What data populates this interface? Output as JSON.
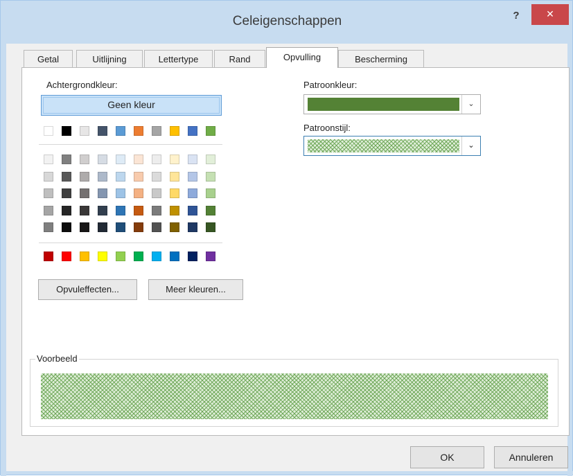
{
  "window": {
    "title": "Celeigenschappen",
    "help_label": "?",
    "close_label": "✕"
  },
  "tabs": [
    {
      "label": "Getal"
    },
    {
      "label": "Uitlijning"
    },
    {
      "label": "Lettertype"
    },
    {
      "label": "Rand"
    },
    {
      "label": "Opvulling",
      "active": true
    },
    {
      "label": "Bescherming"
    }
  ],
  "fill_panel": {
    "background_color_label": "Achtergrondkleur:",
    "no_color_label": "Geen kleur",
    "fill_effects_label": "Opvuleffecten...",
    "more_colors_label": "Meer kleuren...",
    "pattern_color_label": "Patroonkleur:",
    "pattern_color_value": "#548235",
    "pattern_style_label": "Patroonstijl:",
    "pattern_style_value": "crosshatch",
    "preview_label": "Voorbeeld"
  },
  "palette": {
    "theme_row": [
      "#ffffff",
      "#000000",
      "#e7e6e6",
      "#44546a",
      "#5b9bd5",
      "#ed7d31",
      "#a5a5a5",
      "#ffc000",
      "#4472c4",
      "#70ad47"
    ],
    "tint_rows": [
      [
        "#f2f2f2",
        "#808080",
        "#d0cece",
        "#d6dce4",
        "#deebf6",
        "#fbe5d5",
        "#ededed",
        "#fff2cc",
        "#dae3f3",
        "#e2efd9"
      ],
      [
        "#d8d8d8",
        "#595959",
        "#aeabab",
        "#adb9ca",
        "#bdd7ee",
        "#f8cbad",
        "#dbdbdb",
        "#ffe599",
        "#b4c6e7",
        "#c5e0b3"
      ],
      [
        "#bfbfbf",
        "#404040",
        "#757171",
        "#8496b0",
        "#9dc3e6",
        "#f4b183",
        "#c9c9c9",
        "#ffd966",
        "#8eaadb",
        "#a8d08d"
      ],
      [
        "#a5a5a5",
        "#262626",
        "#3a3838",
        "#323f4f",
        "#2e75b5",
        "#c55a11",
        "#7b7b7b",
        "#bf9000",
        "#2f5496",
        "#538135"
      ],
      [
        "#7f7f7f",
        "#0d0d0d",
        "#171616",
        "#222a35",
        "#1f4e79",
        "#843c0c",
        "#525252",
        "#7f6000",
        "#1f3864",
        "#375623"
      ]
    ],
    "standard_row": [
      "#c00000",
      "#ff0000",
      "#ffc000",
      "#ffff00",
      "#92d050",
      "#00b050",
      "#00b0f0",
      "#0070c0",
      "#002060",
      "#7030a0"
    ]
  },
  "footer": {
    "ok_label": "OK",
    "cancel_label": "Annuleren"
  }
}
